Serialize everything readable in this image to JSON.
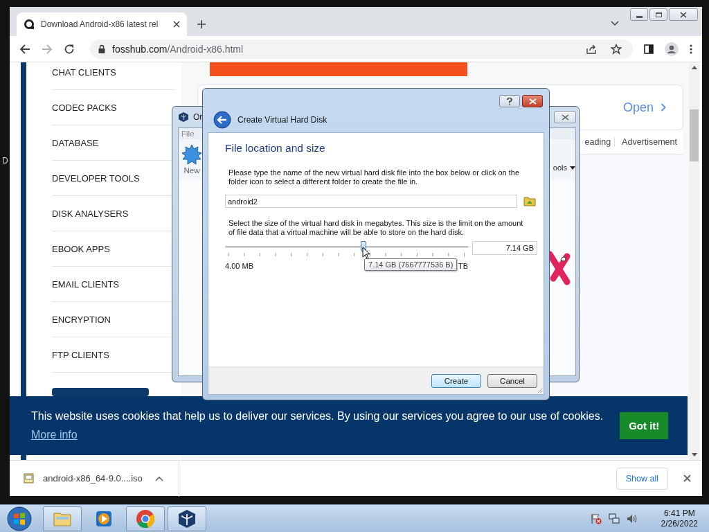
{
  "desktop": {
    "label": "D"
  },
  "browser": {
    "tab": {
      "title": "Download Android-x86 latest rel",
      "selected": true
    },
    "address": {
      "host": "fosshub.com",
      "path": "/Android-x86.html"
    },
    "sidebar": {
      "items": [
        {
          "label": "CHAT CLIENTS"
        },
        {
          "label": "CODEC PACKS"
        },
        {
          "label": "DATABASE"
        },
        {
          "label": "DEVELOPER TOOLS"
        },
        {
          "label": "DISK ANALYSERS"
        },
        {
          "label": "EBOOK APPS"
        },
        {
          "label": "EMAIL CLIENTS"
        },
        {
          "label": "ENCRYPTION"
        },
        {
          "label": "FTP CLIENTS"
        }
      ]
    },
    "page": {
      "open_link": "Open",
      "tabs": [
        {
          "label": "eading"
        },
        {
          "label": "Advertisement"
        }
      ]
    },
    "cookie_banner": {
      "message": "This website uses cookies that help us to deliver our services. By using our services you agree to our use of cookies.",
      "link": "More info",
      "button": "Got it!"
    },
    "downloads": {
      "file": "android-x86_64-9.0....iso",
      "show_all": "Show all"
    }
  },
  "manager_window": {
    "title": "Or",
    "menu": [
      "File"
    ],
    "toolbar": [
      {
        "kind": "new",
        "label": "New"
      },
      {
        "kind": "tools",
        "label": "ools"
      }
    ]
  },
  "dialog": {
    "title": "Create Virtual Hard Disk",
    "heading": "File location and size",
    "instructions": "Please type the name of the new virtual hard disk file into the box below or click on the folder icon to select a different folder to create the file in.",
    "file_name": "android2",
    "size_instructions": "Select the size of the virtual hard disk in megabytes. This size is the limit on the amount of file data that a virtual machine will be able to store on the hard disk.",
    "size": {
      "level": 0.57,
      "min_label": "4.00 MB",
      "max_label": "TB",
      "value": "7.14 GB",
      "tooltip": "7.14 GB (7667777536 B)"
    },
    "buttons": [
      {
        "label": "Create",
        "default": true
      },
      {
        "label": "Cancel",
        "default": false
      }
    ]
  },
  "taskbar": {
    "apps": [
      {
        "kind": "explorer",
        "running": true
      },
      {
        "kind": "media",
        "running": false
      },
      {
        "kind": "chrome",
        "running": true
      },
      {
        "kind": "virtualbox",
        "running": true
      }
    ],
    "time": "6:41 PM",
    "date": "2/26/2022"
  }
}
